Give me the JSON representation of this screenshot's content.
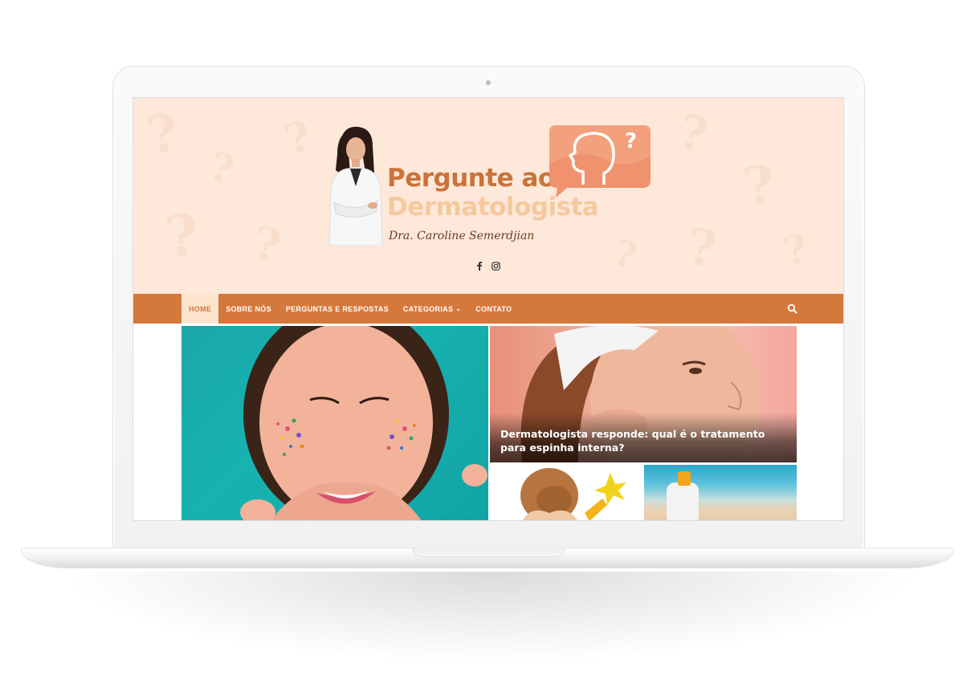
{
  "site": {
    "title_line1": "Pergunte ao",
    "title_line2": "Dermatologista",
    "subtitle": "Dra. Caroline Semerdjian"
  },
  "social": {
    "icons": [
      "facebook-icon",
      "instagram-icon"
    ]
  },
  "nav": {
    "items": [
      {
        "label": "HOME",
        "active": true
      },
      {
        "label": "SOBRE NÓS",
        "active": false
      },
      {
        "label": "PERGUNTAS E RESPOSTAS",
        "active": false
      },
      {
        "label": "CATEGORIAS",
        "active": false,
        "has_dropdown": true
      },
      {
        "label": "CONTATO",
        "active": false
      }
    ],
    "search_icon": "search-icon"
  },
  "featured": {
    "right_title": "Dermatologista responde: qual é o tratamento para espinha interna?"
  },
  "colors": {
    "header_bg": "#fde8da",
    "nav_bg": "#d5783c",
    "brand_orange": "#c9733a",
    "brand_peach": "#f5c99d"
  }
}
